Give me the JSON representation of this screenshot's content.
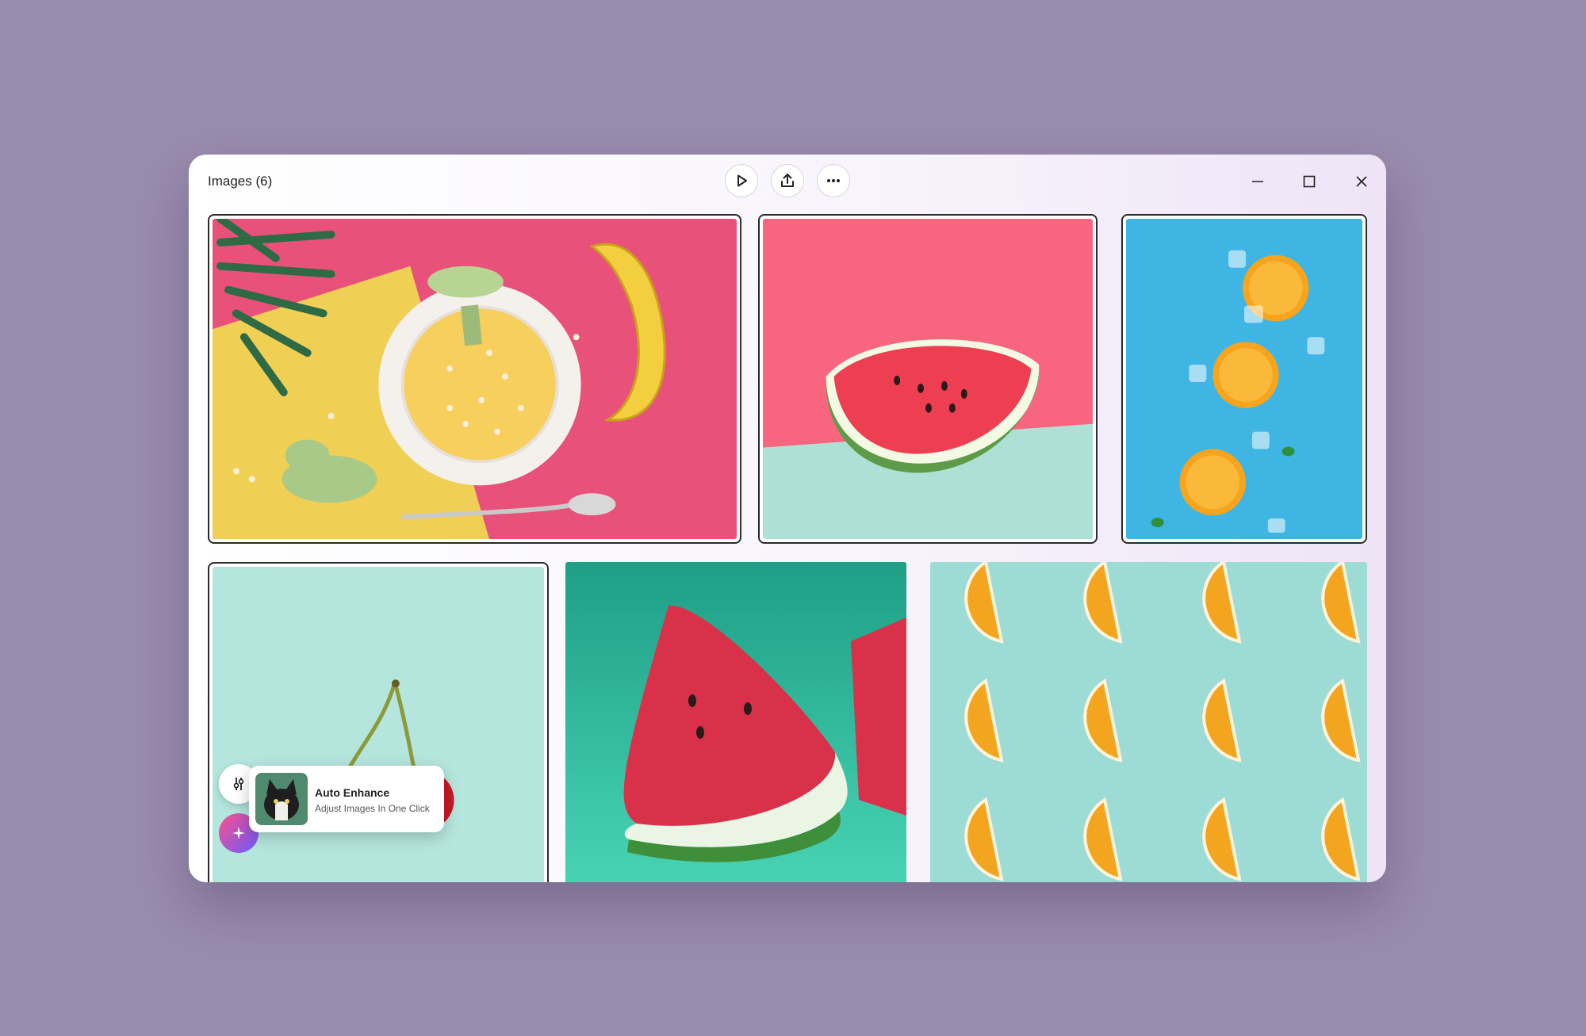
{
  "window": {
    "title": "Images (6)",
    "toolbar": {
      "play_icon": "play-icon",
      "share_icon": "share-icon",
      "more_icon": "more-horizontal-icon"
    },
    "controls": {
      "minimize_icon": "minimize-icon",
      "maximize_icon": "maximize-icon",
      "close_icon": "close-icon"
    }
  },
  "images": [
    {
      "subject": "tropical-bowl-banana",
      "selected": true
    },
    {
      "subject": "watermelon-slice-pink",
      "selected": true
    },
    {
      "subject": "orange-halves-ice",
      "selected": true
    },
    {
      "subject": "cherries-mint",
      "selected": true
    },
    {
      "subject": "watermelon-wedges-teal",
      "selected": false
    },
    {
      "subject": "orange-slices-pattern",
      "selected": false
    }
  ],
  "popup": {
    "title": "Auto Enhance",
    "subtitle": "Adjust Images In One Click"
  },
  "colors": {
    "background": "#9a8cad",
    "accent_gradient_start": "#ff4f8b",
    "accent_gradient_end": "#6a5cff"
  }
}
